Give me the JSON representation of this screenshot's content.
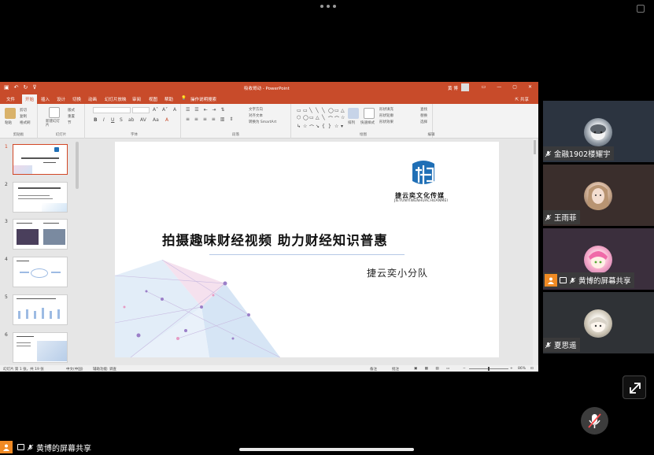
{
  "powerpoint": {
    "window_title": "吸收哥动 - PowerPoint",
    "user_name": "黄 博",
    "share_label": "共享",
    "tabs": [
      "文件",
      "开始",
      "插入",
      "设计",
      "切换",
      "动画",
      "幻灯片放映",
      "审阅",
      "视图",
      "帮助"
    ],
    "active_tab": "开始",
    "tell_me": "操作说明搜索",
    "ribbon_groups": [
      "剪贴板",
      "幻灯片",
      "字体",
      "段落",
      "绘图",
      "编辑"
    ],
    "ribbon_labels": {
      "paste": "粘贴",
      "cut": "剪切",
      "copy": "复制",
      "format_painter": "格式刷",
      "new_slide": "新建幻灯片",
      "layout": "版式",
      "reset": "重置",
      "section": "节",
      "text_direction": "文字方向",
      "align_text": "对齐文本",
      "smartart": "转换为 SmartArt",
      "arrange": "排列",
      "quick_styles": "快速样式",
      "shape_fill": "形状填充",
      "shape_outline": "形状轮廓",
      "shape_effects": "形状效果",
      "find": "查找",
      "replace": "替换",
      "select": "选择"
    },
    "slide_numbers": [
      "1",
      "2",
      "3",
      "4",
      "5",
      "6"
    ],
    "slide": {
      "logo_cn": "捷云奕文化传媒",
      "logo_en": "JIEYUNYIWENHUACHUANMEI",
      "title": "拍摄趣味财经视频 助力财经知识普惠",
      "subtitle": "捷云奕小分队"
    },
    "status": {
      "slide_count": "幻灯片 第 1 张，共 19 张",
      "language": "中文(中国)",
      "accessibility": "辅助功能: 调查",
      "notes": "备注",
      "comments": "批注",
      "zoom": "86%"
    }
  },
  "participants": [
    {
      "name": "金融1902楼耀宇"
    },
    {
      "name": "王雨菲"
    },
    {
      "name": "黄博的屏幕共享"
    },
    {
      "name": "夏思遥"
    }
  ],
  "bottom_share_label": "黄博的屏幕共享",
  "colors": {
    "accent": "#c84b2a",
    "selected_thumb": "#d24726",
    "share_icon": "#f08a24"
  }
}
